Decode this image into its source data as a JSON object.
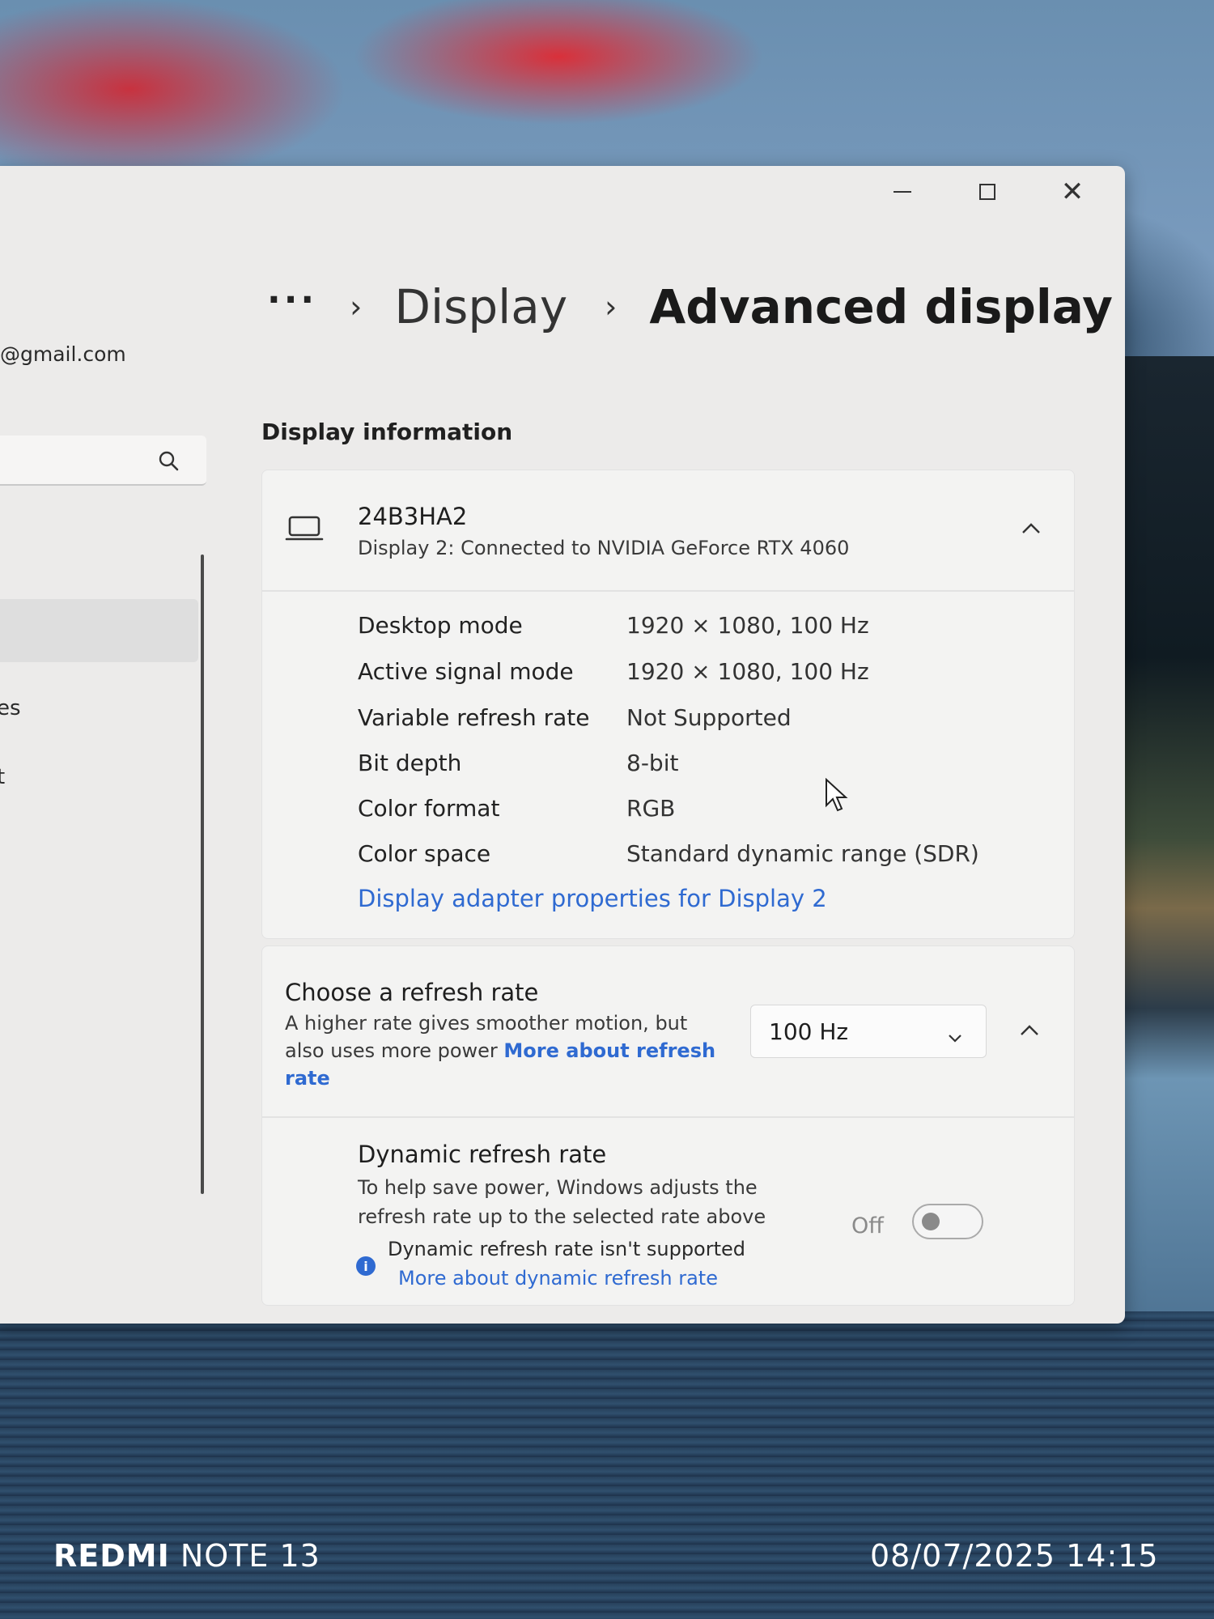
{
  "window": {
    "controls": {
      "minimize": "minimize",
      "maximize": "maximize",
      "close": "close"
    }
  },
  "sidebar": {
    "account_email": "@gmail.com",
    "nav_partial_1": "es",
    "nav_partial_2": "t"
  },
  "breadcrumb": {
    "more": "···",
    "separator": "›",
    "parent": "Display",
    "current": "Advanced display"
  },
  "display_information": {
    "section_title": "Display information",
    "monitor": {
      "name": "24B3HA2",
      "subtitle": "Display 2: Connected to NVIDIA GeForce RTX 4060",
      "icon": "laptop-monitor-icon"
    },
    "rows": [
      {
        "label": "Desktop mode",
        "value": "1920 × 1080, 100 Hz"
      },
      {
        "label": "Active signal mode",
        "value": "1920 × 1080, 100 Hz"
      },
      {
        "label": "Variable refresh rate",
        "value": "Not Supported"
      },
      {
        "label": "Bit depth",
        "value": "8-bit"
      },
      {
        "label": "Color format",
        "value": "RGB"
      },
      {
        "label": "Color space",
        "value": "Standard dynamic range (SDR)"
      }
    ],
    "adapter_link": "Display adapter properties for Display 2"
  },
  "refresh_rate": {
    "title": "Choose a refresh rate",
    "description": "A higher rate gives smoother motion, but also uses more power",
    "link": "More about refresh rate",
    "selected": "100 Hz"
  },
  "dynamic_refresh": {
    "title": "Dynamic refresh rate",
    "description": "To help save power, Windows adjusts the refresh rate up to the selected rate above",
    "unsupported": "Dynamic refresh rate isn't supported",
    "link": "More about dynamic refresh rate",
    "toggle_label": "Off",
    "toggle_on": false
  },
  "photo_watermark": {
    "brand": "REDMI",
    "model": "NOTE 13",
    "datetime": "08/07/2025 14:15"
  },
  "colors": {
    "accent": "#2f6ad1",
    "window_bg": "#ecebea",
    "card_bg": "#f3f3f2"
  }
}
